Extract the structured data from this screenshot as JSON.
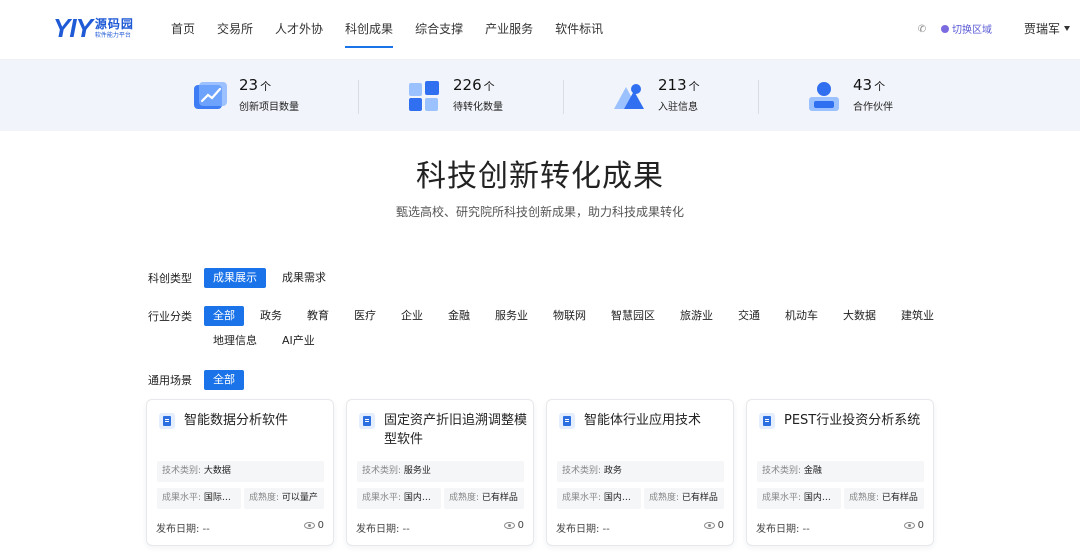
{
  "header": {
    "logo_mark": "YIY",
    "logo_name": "源码园",
    "logo_slogan": "软件能力平台",
    "nav": [
      {
        "label": "首页",
        "active": false
      },
      {
        "label": "交易所",
        "active": false
      },
      {
        "label": "人才外协",
        "active": false
      },
      {
        "label": "科创成果",
        "active": true
      },
      {
        "label": "综合支撑",
        "active": false
      },
      {
        "label": "产业服务",
        "active": false
      },
      {
        "label": "软件标讯",
        "active": false
      }
    ],
    "phone_icon": "phone-icon",
    "region_label": "切换区域",
    "user_name": "贾瑞军"
  },
  "stats": [
    {
      "num": "23",
      "unit": "个",
      "label": "创新项目数量",
      "icon": "chart-folder-icon"
    },
    {
      "num": "226",
      "unit": "个",
      "label": "待转化数量",
      "icon": "grid-blocks-icon"
    },
    {
      "num": "213",
      "unit": "个",
      "label": "入驻信息",
      "icon": "triangle-shapes-icon"
    },
    {
      "num": "43",
      "unit": "个",
      "label": "合作伙伴",
      "icon": "person-card-icon"
    }
  ],
  "hero": {
    "title": "科技创新转化成果",
    "subtitle": "甄选高校、研究院所科技创新成果，助力科技成果转化"
  },
  "filters": {
    "type_label": "科创类型",
    "type_options": [
      "成果展示",
      "成果需求"
    ],
    "industry_label": "行业分类",
    "industry_options": [
      "全部",
      "政务",
      "教育",
      "医疗",
      "企业",
      "金融",
      "服务业",
      "物联网",
      "智慧园区",
      "旅游业",
      "交通",
      "机动车",
      "大数据",
      "建筑业"
    ],
    "industry_options_row2": [
      "地理信息",
      "AI产业"
    ],
    "scene_label": "通用场景",
    "scene_options": [
      "全部"
    ]
  },
  "cards": [
    {
      "title": "智能数据分析软件",
      "tech_key": "技术类别:",
      "tech_val": "大数据",
      "level_key": "成果水平:",
      "level_val": "国际…",
      "mature_key": "成熟度:",
      "mature_val": "可以量产",
      "date": "发布日期: --",
      "views": "0"
    },
    {
      "title": "固定资产折旧追溯调整模型软件",
      "tech_key": "技术类别:",
      "tech_val": "服务业",
      "level_key": "成果水平:",
      "level_val": "国内…",
      "mature_key": "成熟度:",
      "mature_val": "已有样品",
      "date": "发布日期: --",
      "views": "0"
    },
    {
      "title": "智能体行业应用技术",
      "tech_key": "技术类别:",
      "tech_val": "政务",
      "level_key": "成果水平:",
      "level_val": "国内…",
      "mature_key": "成熟度:",
      "mature_val": "已有样品",
      "date": "发布日期: --",
      "views": "0"
    },
    {
      "title": "PEST行业投资分析系统",
      "tech_key": "技术类别:",
      "tech_val": "金融",
      "level_key": "成果水平:",
      "level_val": "国内…",
      "mature_key": "成熟度:",
      "mature_val": "已有样品",
      "date": "发布日期: --",
      "views": "0"
    }
  ],
  "colors": {
    "accent": "#1a73e8",
    "brand": "#1f5ad6",
    "region": "#5b5bd6"
  }
}
